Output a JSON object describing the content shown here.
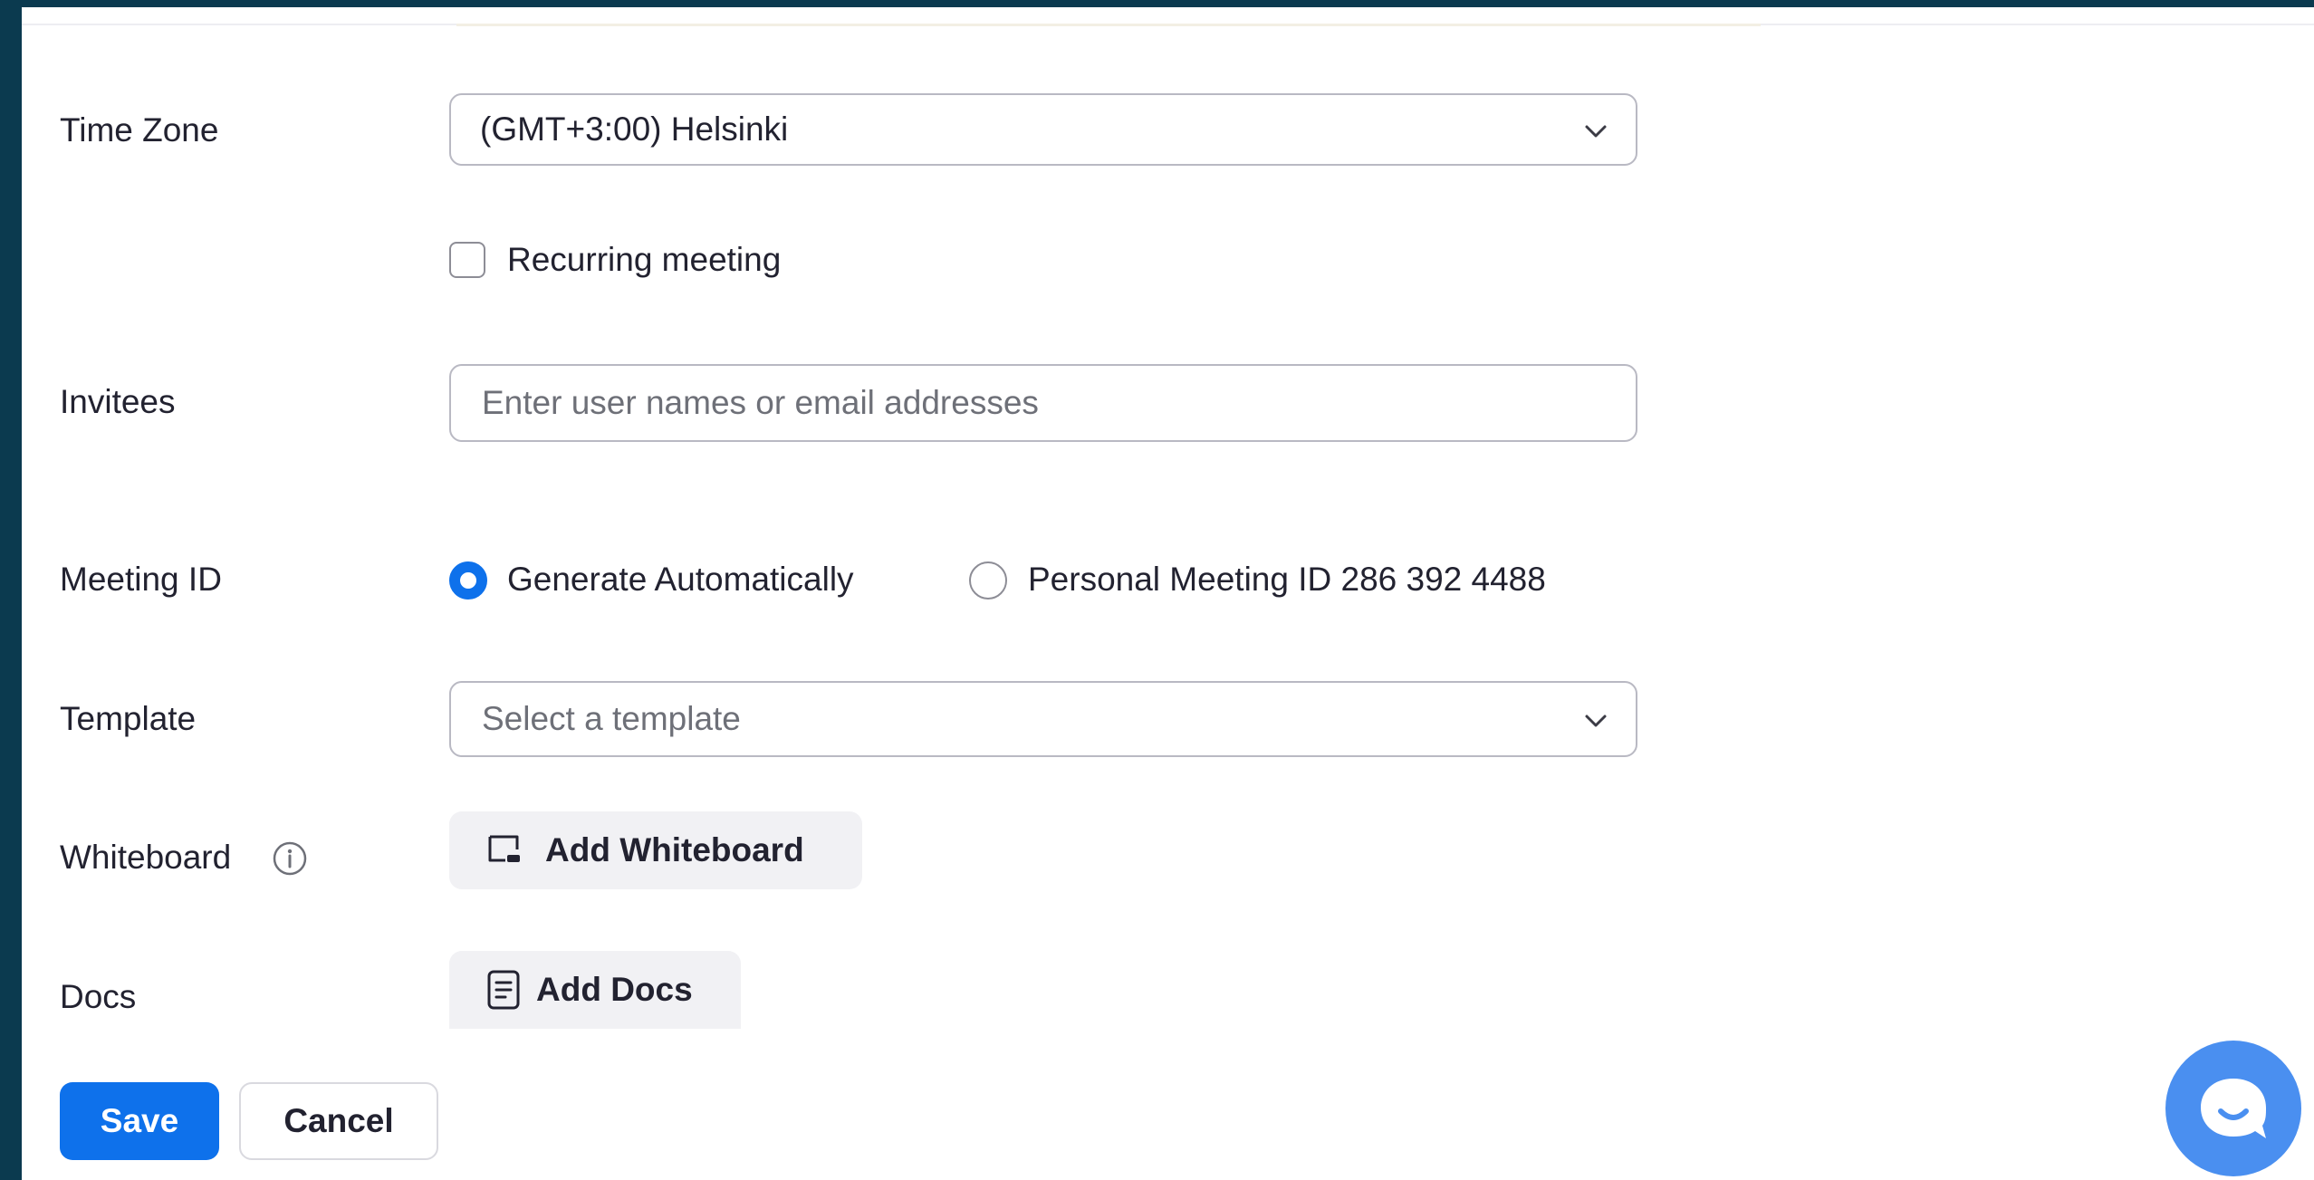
{
  "form": {
    "time_zone": {
      "label": "Time Zone",
      "value": "(GMT+3:00) Helsinki"
    },
    "recurring": {
      "label": "Recurring meeting",
      "checked": false
    },
    "invitees": {
      "label": "Invitees",
      "placeholder": "Enter user names or email addresses",
      "value": ""
    },
    "meeting_id": {
      "label": "Meeting ID",
      "options": [
        {
          "label": "Generate Automatically",
          "selected": true
        },
        {
          "label": "Personal Meeting ID 286 392 4488",
          "selected": false
        }
      ]
    },
    "template": {
      "label": "Template",
      "placeholder": "Select a template"
    },
    "whiteboard": {
      "label": "Whiteboard",
      "button_label": "Add Whiteboard"
    },
    "docs": {
      "label": "Docs",
      "button_label": "Add Docs"
    }
  },
  "actions": {
    "save_label": "Save",
    "cancel_label": "Cancel"
  },
  "icons": {
    "dropdown": "chevron-down-icon",
    "info": "info-icon",
    "whiteboard": "whiteboard-icon",
    "docs": "document-icon",
    "chat": "chat-bubble-icon"
  },
  "colors": {
    "accent": "#0e71eb",
    "chat_button": "#4a8ff0",
    "frame": "#0b3a4f"
  }
}
